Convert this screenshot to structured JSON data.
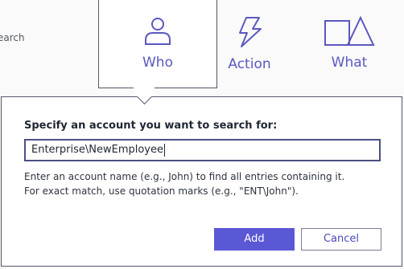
{
  "search_hint": "earch",
  "tabs": [
    {
      "label": "Who",
      "icon": "user-icon"
    },
    {
      "label": "Action",
      "icon": "lightning-icon"
    },
    {
      "label": "What",
      "icon": "shapes-icon"
    }
  ],
  "dialog": {
    "prompt": "Specify an account you want to search for:",
    "input_value": "Enterprise\\NewEmployee",
    "help_line1": "Enter an account name (e.g., John) to find all entries containing it.",
    "help_line2": "For exact match, use quotation marks (e.g., \"ENT\\John\").",
    "add_label": "Add",
    "cancel_label": "Cancel"
  },
  "colors": {
    "accent": "#5b58d6",
    "icon": "#5b58bf",
    "border": "#52576a"
  }
}
